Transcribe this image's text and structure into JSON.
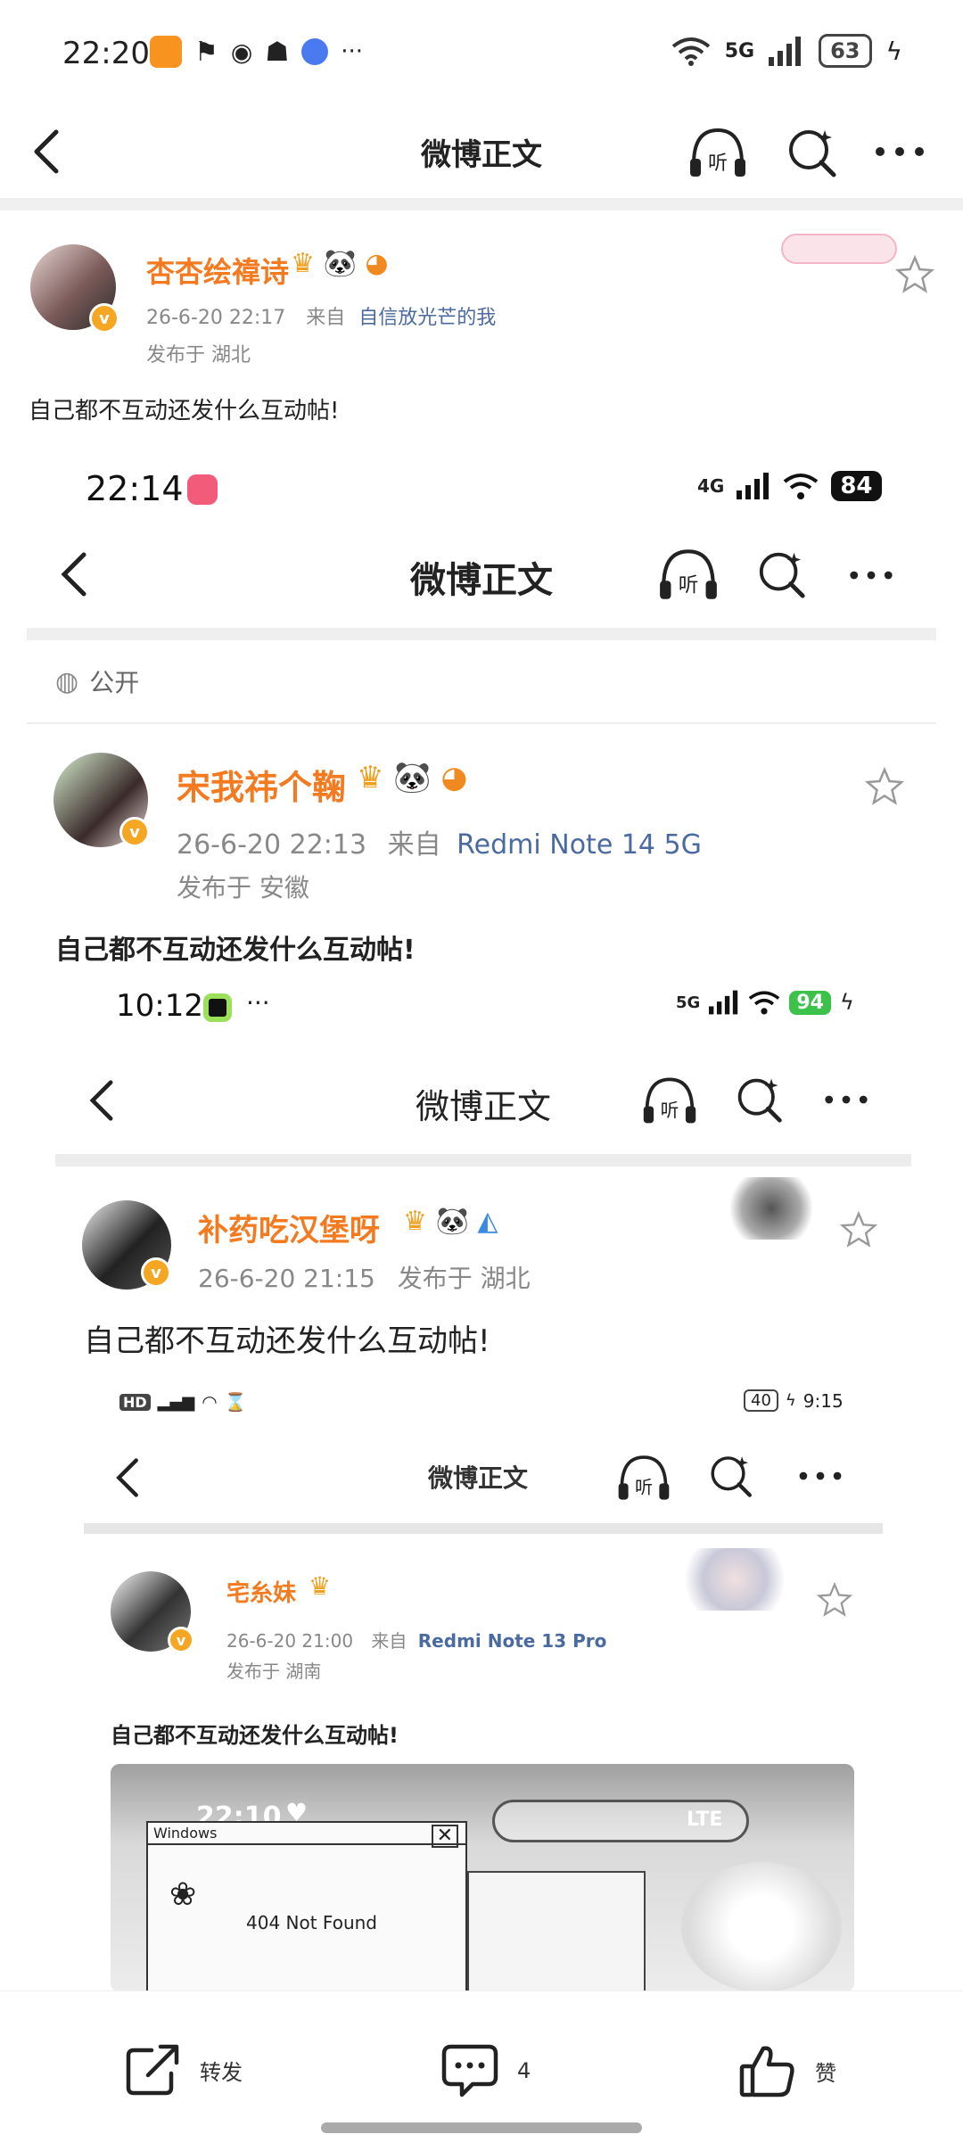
{
  "status": {
    "time": "22:20",
    "signal": "5G",
    "battery": "63"
  },
  "nav": {
    "title": "微博正文"
  },
  "post": {
    "username": "杏杏绘禕诗",
    "date": "26-6-20 22:17",
    "from_label": "来自",
    "source": "自信放光芒的我",
    "location": "发布于 湖北",
    "text": "自己都不互动还发什么互动帖!"
  },
  "nested1": {
    "status_time": "22:14",
    "signal": "4G",
    "battery": "84",
    "nav_title": "微博正文",
    "visibility": "公开",
    "username": "宋我祎个鞠",
    "date": "26-6-20 22:13",
    "from_label": "来自",
    "source": "Redmi Note 14 5G",
    "location": "发布于 安徽",
    "text": "自己都不互动还发什么互动帖!"
  },
  "nested2": {
    "status_time": "10:12",
    "signal": "5G",
    "battery": "94",
    "nav_title": "微博正文",
    "username": "补药吃汉堡呀",
    "date": "26-6-20 21:15",
    "location": "发布于 湖北",
    "text": "自己都不互动还发什么互动帖!"
  },
  "nested3": {
    "status_left": "HD",
    "battery": "40",
    "status_time": "9:15",
    "nav_title": "微博正文",
    "username": "宅糸妹",
    "date": "26-6-20 21:00",
    "from_label": "来自",
    "source": "Redmi Note 13 Pro",
    "location": "发布于 湖南",
    "text": "自己都不互动还发什么互动帖!"
  },
  "nested4": {
    "status_time": "22:10",
    "window_title": "Windows",
    "error_text": "404 Not Found",
    "lte": "LTE"
  },
  "bottom": {
    "repost": "转发",
    "comment_count": "4",
    "like": "赞"
  },
  "colors": {
    "username": "#f47a20",
    "source_link": "#4a6aa0",
    "battery_green": "#3cc24a"
  }
}
